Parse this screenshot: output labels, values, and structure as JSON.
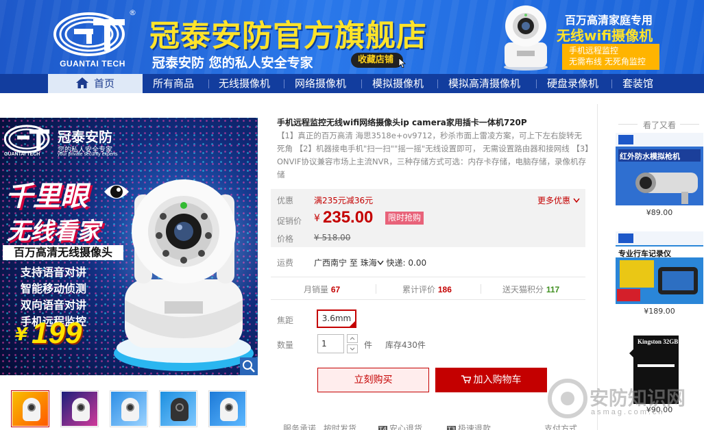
{
  "banner": {
    "logo_text": "GUANTAI TECH",
    "registered": "®",
    "store_title": "冠泰安防官方旗舰店",
    "slogan": "冠泰安防 您的私人安全专家",
    "favorite_label": "收藏店铺",
    "right_line1": "百万高清家庭专用",
    "right_line2": "无线wifi摄像机",
    "tag_line1": "手机远程监控",
    "tag_line2": "无需布线  无死角监控"
  },
  "nav": {
    "items": [
      "首页",
      "所有商品",
      "无线摄像机",
      "网络摄像机",
      "模拟摄像机",
      "模拟高清摄像机",
      "硬盘录像机",
      "套装馆"
    ]
  },
  "main_image": {
    "logo_text": "GUANTAI TECH",
    "brand": "冠泰安防",
    "brand_slogan": "您的私人安全专家",
    "brand_en": "your private security experts",
    "headline1": "千里眼",
    "headline2": "无线看家",
    "sub_banner": "百万高清无线摄像头",
    "features": [
      "支持语音对讲",
      "智能移动侦测",
      "双向语音对讲",
      "手机远程监控"
    ],
    "price_sign": "¥",
    "price": "199"
  },
  "product": {
    "title": "手机远程监控无线wifi网络摄像头ip camera家用插卡一体机720P",
    "description": "【1】真正的百万高清 海思3518e+ov9712，秒杀市面上雷凌方案，可上下左右旋转无死角 【2】机器接电手机\"扫一扫\"\"摇一摇\"无线设置即可， 无需设置路由器和接网线 【3】ONVIF协议兼容市场上主流NVR，三种存储方式可选：内存卡存储，电脑存储，录像机存储",
    "promo_label": "优惠",
    "promo_text": "满235元减36元",
    "more_promo": "更多优惠",
    "price_label": "促销价",
    "currency": "¥",
    "price": "235.00",
    "flash_badge": "限时抢购",
    "orig_label": "价格",
    "orig_price": "¥ 518.00",
    "ship_label": "运费",
    "ship_from": "广西南宁",
    "ship_to_word": "至",
    "ship_to": "珠海",
    "ship_fee": "快递: 0.00",
    "stats": [
      {
        "label": "月销量",
        "value": "67",
        "color": "#c40000"
      },
      {
        "label": "累计评价",
        "value": "186",
        "color": "#c40000"
      },
      {
        "label": "送天猫积分",
        "value": "117",
        "color": "#3f8f1f"
      }
    ],
    "focal_label": "焦距",
    "focal_value": "3.6mm",
    "qty_label": "数量",
    "qty_value": "1",
    "qty_unit": "件",
    "stock": "库存430件",
    "buy_label": "立刻购买",
    "cart_label": "加入购物车",
    "services_label": "服务承诺",
    "services": [
      {
        "icon": "",
        "text": "按时发货"
      },
      {
        "icon": "T4",
        "text": "安心退货"
      },
      {
        "icon": "T3",
        "text": "极速退款"
      }
    ],
    "payment_label": "支付方式"
  },
  "sidebar": {
    "title": "看了又看",
    "items": [
      {
        "title": "红外防水模拟枪机",
        "price": "¥89.00"
      },
      {
        "title": "专业行车记录仪",
        "price": "¥189.00"
      },
      {
        "title": "Kingston 32GB",
        "price": "¥90.00"
      }
    ]
  },
  "watermark": {
    "text": "安防知识网",
    "url": "asmag.com.cn"
  },
  "colors": {
    "accent": "#c40000",
    "nav_bg": "#123d9e",
    "banner_bg": "#2a78ea",
    "promo_badge": "#e8637a"
  }
}
